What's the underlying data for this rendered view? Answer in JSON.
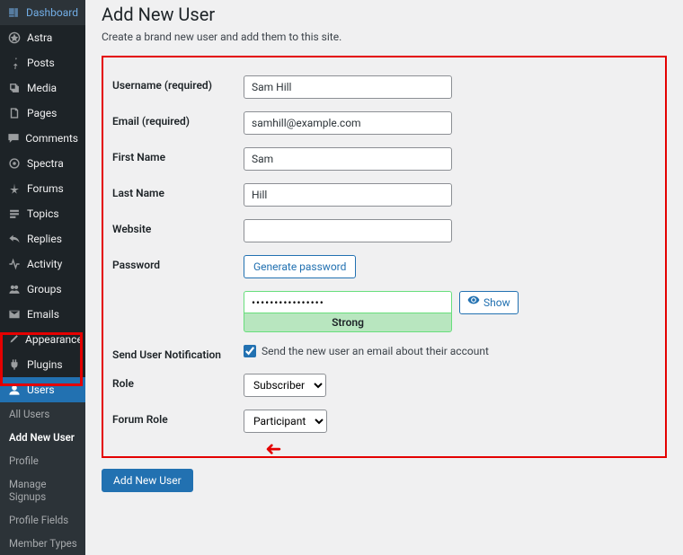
{
  "sidebar": {
    "items": [
      {
        "label": "Dashboard",
        "icon": "dashboard"
      },
      {
        "label": "Astra",
        "icon": "astra"
      },
      {
        "label": "Posts",
        "icon": "pin"
      },
      {
        "label": "Media",
        "icon": "media"
      },
      {
        "label": "Pages",
        "icon": "pages"
      },
      {
        "label": "Comments",
        "icon": "comment"
      },
      {
        "label": "Spectra",
        "icon": "spectra"
      },
      {
        "label": "Forums",
        "icon": "forums"
      },
      {
        "label": "Topics",
        "icon": "topics"
      },
      {
        "label": "Replies",
        "icon": "replies"
      },
      {
        "label": "Activity",
        "icon": "activity"
      },
      {
        "label": "Groups",
        "icon": "groups"
      },
      {
        "label": "Emails",
        "icon": "emails"
      },
      {
        "label": "Appearance",
        "icon": "appearance"
      },
      {
        "label": "Plugins",
        "icon": "plugins"
      },
      {
        "label": "Users",
        "icon": "users"
      }
    ],
    "submenu": [
      {
        "label": "All Users"
      },
      {
        "label": "Add New User"
      },
      {
        "label": "Profile"
      },
      {
        "label": "Manage Signups"
      },
      {
        "label": "Profile Fields"
      },
      {
        "label": "Member Types"
      }
    ]
  },
  "page": {
    "title": "Add New User",
    "description": "Create a brand new user and add them to this site."
  },
  "form": {
    "username_label": "Username (required)",
    "username_value": "Sam Hill",
    "email_label": "Email (required)",
    "email_value": "samhill@example.com",
    "firstname_label": "First Name",
    "firstname_value": "Sam",
    "lastname_label": "Last Name",
    "lastname_value": "Hill",
    "website_label": "Website",
    "website_value": "",
    "password_label": "Password",
    "generate_btn": "Generate password",
    "password_value": "••••••••••••••••",
    "strength": "Strong",
    "show_btn": "Show",
    "notification_label": "Send User Notification",
    "notification_checkbox": "Send the new user an email about their account",
    "role_label": "Role",
    "role_value": "Subscriber",
    "forum_role_label": "Forum Role",
    "forum_role_value": "Participant",
    "submit": "Add New User"
  }
}
